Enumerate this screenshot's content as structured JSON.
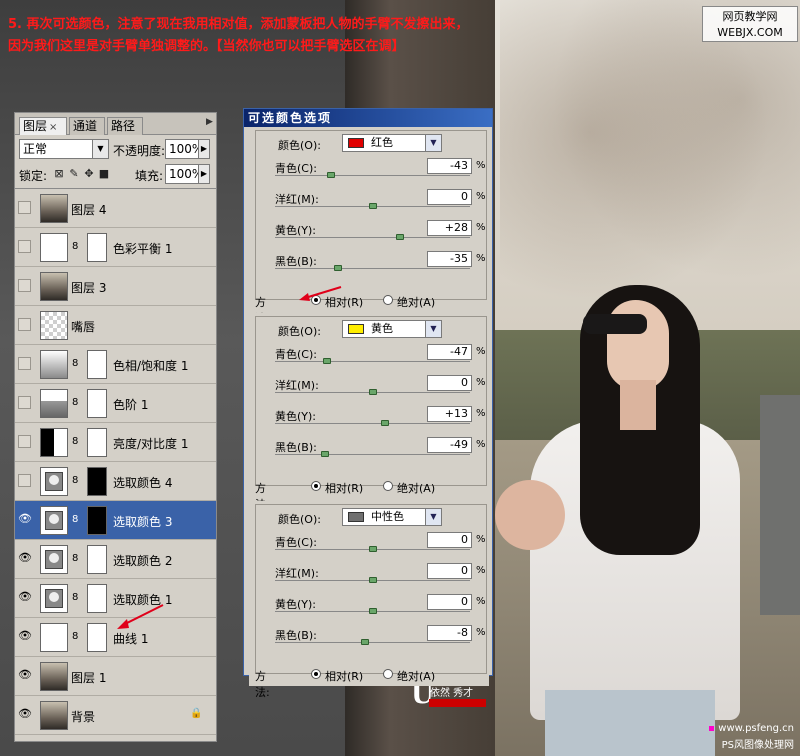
{
  "caption": {
    "line1": "5. 再次可选颜色，注意了现在我用相对值，添加蒙板把人物的手臂不发擦出来，",
    "line2": "因为我们这里是对手臂单独调整的。【当然你也可以把手臂选区在调】"
  },
  "watermark_top": {
    "line1": "网页教学网",
    "line2": "WEBJX.COM"
  },
  "watermark_bottom": {
    "line1": "www.psfeng.cn",
    "line2": "PS风图像处理网"
  },
  "logo": {
    "letter": "U",
    "name": "依然 秀才"
  },
  "colors": {
    "caption": "#ff1a1a",
    "selection": "#3a62a8",
    "title_bar": "#0a246a",
    "arrow": "#e0001a"
  },
  "layers_panel": {
    "tabs": [
      {
        "label": "图层",
        "close": "×"
      },
      {
        "label": "通道"
      },
      {
        "label": "路径"
      }
    ],
    "menu_icon": "▶",
    "blend_mode": "正常",
    "opacity_label": "不透明度:",
    "opacity": "100%",
    "lock_label": "锁定:",
    "fill_label": "填充:",
    "fill": "100%",
    "layers": [
      {
        "name": "图层 4",
        "visible": false,
        "thumb": "photo",
        "mask": "none"
      },
      {
        "name": "色彩平衡 1",
        "visible": false,
        "thumb": "bal",
        "mask": "white"
      },
      {
        "name": "图层 3",
        "visible": false,
        "thumb": "photo",
        "mask": "none"
      },
      {
        "name": "嘴唇",
        "visible": false,
        "thumb": "trans",
        "mask": "none"
      },
      {
        "name": "色相/饱和度 1",
        "visible": false,
        "thumb": "hue",
        "mask": "white"
      },
      {
        "name": "色阶 1",
        "visible": false,
        "thumb": "levels",
        "mask": "white"
      },
      {
        "name": "亮度/对比度 1",
        "visible": false,
        "thumb": "bc",
        "mask": "white"
      },
      {
        "name": "选取颜色 4",
        "visible": false,
        "thumb": "adj",
        "mask": "black"
      },
      {
        "name": "选取颜色 3",
        "visible": true,
        "thumb": "adj",
        "mask": "black",
        "selected": true
      },
      {
        "name": "选取颜色 2",
        "visible": true,
        "thumb": "adj",
        "mask": "white"
      },
      {
        "name": "选取颜色 1",
        "visible": true,
        "thumb": "adj",
        "mask": "white"
      },
      {
        "name": "曲线 1",
        "visible": true,
        "thumb": "curves",
        "mask": "white"
      },
      {
        "name": "图层 1",
        "visible": true,
        "thumb": "photo",
        "mask": "none"
      },
      {
        "name": "背景",
        "visible": true,
        "thumb": "photo",
        "mask": "none",
        "locked": true
      }
    ]
  },
  "dialog": {
    "title": "可选颜色选项",
    "method_label": "方法:",
    "relative_label": "相对(R)",
    "absolute_label": "绝对(A)",
    "color_label": "颜色(O):",
    "sections": [
      {
        "color_name": "红色",
        "swatch": "#e00000",
        "method": "relative",
        "sliders": [
          {
            "label": "青色(C):",
            "value": "-43",
            "knob": -43
          },
          {
            "label": "洋红(M):",
            "value": "0",
            "knob": 0
          },
          {
            "label": "黄色(Y):",
            "value": "+28",
            "knob": 28
          },
          {
            "label": "黑色(B):",
            "value": "-35",
            "knob": -35
          }
        ]
      },
      {
        "color_name": "黄色",
        "swatch": "#ffee00",
        "method": "relative",
        "sliders": [
          {
            "label": "青色(C):",
            "value": "-47",
            "knob": -47
          },
          {
            "label": "洋红(M):",
            "value": "0",
            "knob": 0
          },
          {
            "label": "黄色(Y):",
            "value": "+13",
            "knob": 13
          },
          {
            "label": "黑色(B):",
            "value": "-49",
            "knob": -49
          }
        ]
      },
      {
        "color_name": "中性色",
        "swatch": "#707070",
        "method": "relative",
        "sliders": [
          {
            "label": "青色(C):",
            "value": "0",
            "knob": 0
          },
          {
            "label": "洋红(M):",
            "value": "0",
            "knob": 0
          },
          {
            "label": "黄色(Y):",
            "value": "0",
            "knob": 0
          },
          {
            "label": "黑色(B):",
            "value": "-8",
            "knob": -8
          }
        ]
      }
    ]
  }
}
